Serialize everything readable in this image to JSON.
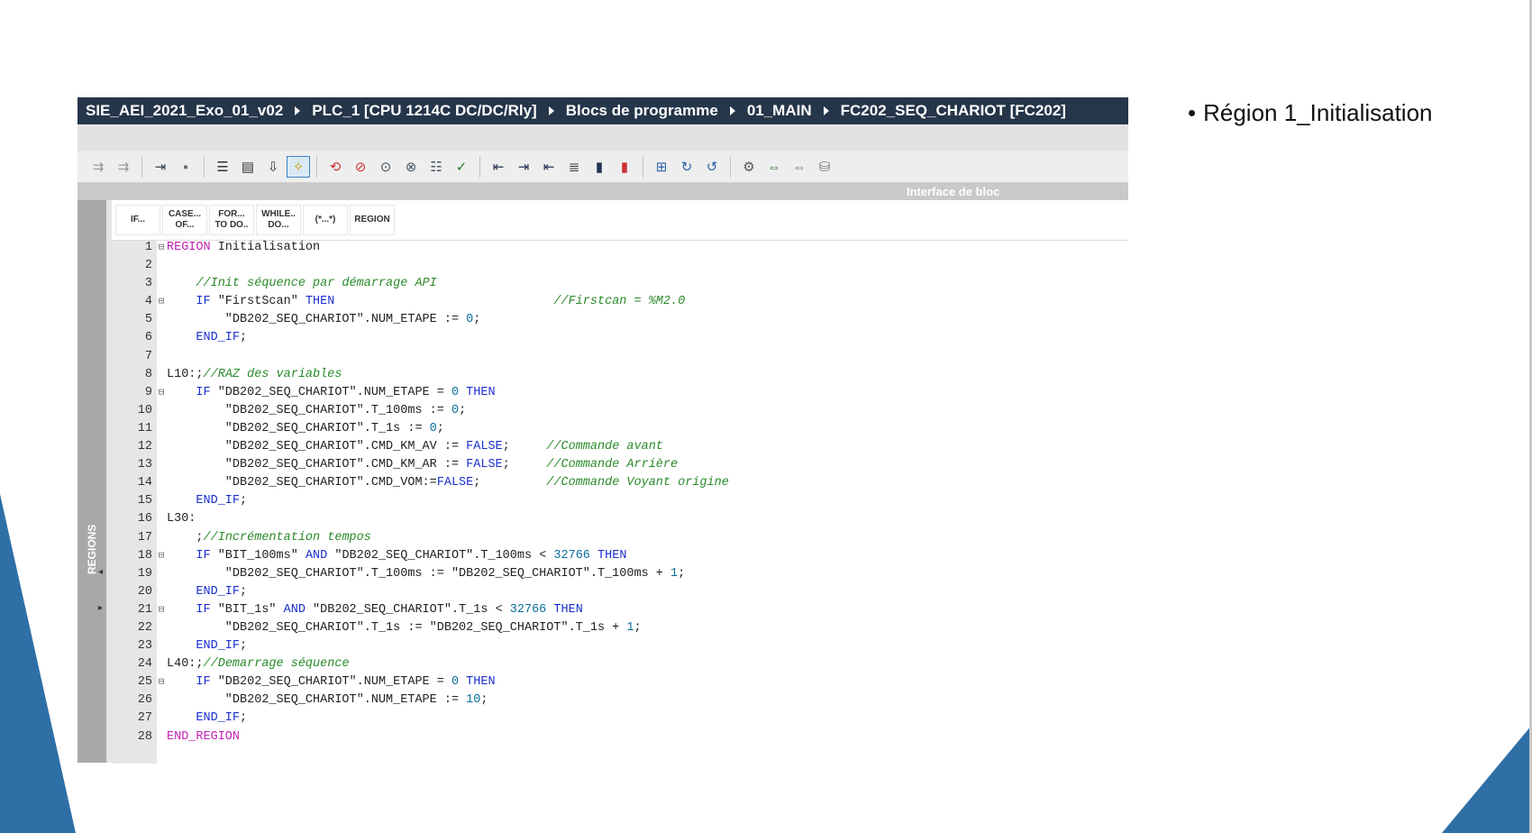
{
  "slide": {
    "bullet": "Région 1_Initialisation"
  },
  "breadcrumb": [
    "SIE_AEI_2021_Exo_01_v02",
    "PLC_1 [CPU 1214C DC/DC/Rly]",
    "Blocs de programme",
    "01_MAIN",
    "FC202_SEQ_CHARIOT [FC202]"
  ],
  "subbar": {
    "label": "Interface de bloc"
  },
  "side_panel": {
    "label": "REGIONS"
  },
  "snippets": [
    "IF...",
    "CASE...\nOF...",
    "FOR...\nTO DO..",
    "WHILE..\nDO...",
    "(*...*)",
    "REGION"
  ],
  "toolbar_icons": [
    "indent-icon",
    "outdent-icon",
    "insert-icon",
    "clear-icon",
    "list-icon",
    "save-icon",
    "download-icon",
    "snippet-icon",
    "goto-icon",
    "delete-breakpoint-icon",
    "monitor-icon",
    "monitor-stop-icon",
    "align-icon",
    "verify-icon",
    "left-arrow-icon",
    "indent-right-icon",
    "indent-left-icon",
    "format-icon",
    "bookmark-icon",
    "bookmark-clear-icon",
    "compile-icon",
    "next-icon",
    "prev-icon",
    "cross-ref-icon",
    "compare-icon",
    "compare-stop-icon",
    "database-icon"
  ],
  "code": [
    {
      "n": "1",
      "fold": "⊟",
      "t": [
        [
          "reg",
          "REGION"
        ],
        [
          "txt",
          " Initialisation"
        ]
      ]
    },
    {
      "n": "2",
      "fold": "",
      "t": []
    },
    {
      "n": "3",
      "fold": "",
      "t": [
        [
          "txt",
          "    "
        ],
        [
          "cm",
          "//Init séquence par démarrage API"
        ]
      ]
    },
    {
      "n": "4",
      "fold": "⊟",
      "t": [
        [
          "txt",
          "    "
        ],
        [
          "kw",
          "IF"
        ],
        [
          "txt",
          " \"FirstScan\" "
        ],
        [
          "kw",
          "THEN"
        ],
        [
          "txt",
          "                              "
        ],
        [
          "cm",
          "//Firstcan = %M2.0"
        ]
      ]
    },
    {
      "n": "5",
      "fold": "",
      "t": [
        [
          "txt",
          "        \"DB202_SEQ_CHARIOT\".NUM_ETAPE := "
        ],
        [
          "num",
          "0"
        ],
        [
          "txt",
          ";"
        ]
      ]
    },
    {
      "n": "6",
      "fold": "",
      "t": [
        [
          "txt",
          "    "
        ],
        [
          "kw",
          "END_IF"
        ],
        [
          "txt",
          ";"
        ]
      ]
    },
    {
      "n": "7",
      "fold": "",
      "t": []
    },
    {
      "n": "8",
      "fold": "",
      "t": [
        [
          "txt",
          "L10:;"
        ],
        [
          "cm",
          "//RAZ des variables"
        ]
      ]
    },
    {
      "n": "9",
      "fold": "⊟",
      "t": [
        [
          "txt",
          "    "
        ],
        [
          "kw",
          "IF"
        ],
        [
          "txt",
          " \"DB202_SEQ_CHARIOT\".NUM_ETAPE = "
        ],
        [
          "num",
          "0"
        ],
        [
          "txt",
          " "
        ],
        [
          "kw",
          "THEN"
        ]
      ]
    },
    {
      "n": "10",
      "fold": "",
      "t": [
        [
          "txt",
          "        \"DB202_SEQ_CHARIOT\".T_100ms := "
        ],
        [
          "num",
          "0"
        ],
        [
          "txt",
          ";"
        ]
      ]
    },
    {
      "n": "11",
      "fold": "",
      "t": [
        [
          "txt",
          "        \"DB202_SEQ_CHARIOT\".T_1s := "
        ],
        [
          "num",
          "0"
        ],
        [
          "txt",
          ";"
        ]
      ]
    },
    {
      "n": "12",
      "fold": "",
      "t": [
        [
          "txt",
          "        \"DB202_SEQ_CHARIOT\".CMD_KM_AV := "
        ],
        [
          "kw",
          "FALSE"
        ],
        [
          "txt",
          ";     "
        ],
        [
          "cm",
          "//Commande avant"
        ]
      ]
    },
    {
      "n": "13",
      "fold": "",
      "t": [
        [
          "txt",
          "        \"DB202_SEQ_CHARIOT\".CMD_KM_AR := "
        ],
        [
          "kw",
          "FALSE"
        ],
        [
          "txt",
          ";     "
        ],
        [
          "cm",
          "//Commande Arrière"
        ]
      ]
    },
    {
      "n": "14",
      "fold": "",
      "t": [
        [
          "txt",
          "        \"DB202_SEQ_CHARIOT\".CMD_VOM:="
        ],
        [
          "kw",
          "FALSE"
        ],
        [
          "txt",
          ";         "
        ],
        [
          "cm",
          "//Commande Voyant origine"
        ]
      ]
    },
    {
      "n": "15",
      "fold": "",
      "t": [
        [
          "txt",
          "    "
        ],
        [
          "kw",
          "END_IF"
        ],
        [
          "txt",
          ";"
        ]
      ]
    },
    {
      "n": "16",
      "fold": "",
      "t": [
        [
          "txt",
          "L30:"
        ]
      ]
    },
    {
      "n": "17",
      "fold": "",
      "t": [
        [
          "txt",
          "    ;"
        ],
        [
          "cm",
          "//Incrémentation tempos"
        ]
      ]
    },
    {
      "n": "18",
      "fold": "⊟",
      "t": [
        [
          "txt",
          "    "
        ],
        [
          "kw",
          "IF"
        ],
        [
          "txt",
          " \"BIT_100ms\" "
        ],
        [
          "kw",
          "AND"
        ],
        [
          "txt",
          " \"DB202_SEQ_CHARIOT\".T_100ms < "
        ],
        [
          "num",
          "32766"
        ],
        [
          "txt",
          " "
        ],
        [
          "kw",
          "THEN"
        ]
      ]
    },
    {
      "n": "19",
      "fold": "",
      "t": [
        [
          "txt",
          "        \"DB202_SEQ_CHARIOT\".T_100ms := \"DB202_SEQ_CHARIOT\".T_100ms + "
        ],
        [
          "num",
          "1"
        ],
        [
          "txt",
          ";"
        ]
      ]
    },
    {
      "n": "20",
      "fold": "",
      "t": [
        [
          "txt",
          "    "
        ],
        [
          "kw",
          "END_IF"
        ],
        [
          "txt",
          ";"
        ]
      ]
    },
    {
      "n": "21",
      "fold": "⊟",
      "t": [
        [
          "txt",
          "    "
        ],
        [
          "kw",
          "IF"
        ],
        [
          "txt",
          " \"BIT_1s\" "
        ],
        [
          "kw",
          "AND"
        ],
        [
          "txt",
          " \"DB202_SEQ_CHARIOT\".T_1s < "
        ],
        [
          "num",
          "32766"
        ],
        [
          "txt",
          " "
        ],
        [
          "kw",
          "THEN"
        ]
      ]
    },
    {
      "n": "22",
      "fold": "",
      "t": [
        [
          "txt",
          "        \"DB202_SEQ_CHARIOT\".T_1s := \"DB202_SEQ_CHARIOT\".T_1s + "
        ],
        [
          "num",
          "1"
        ],
        [
          "txt",
          ";"
        ]
      ]
    },
    {
      "n": "23",
      "fold": "",
      "t": [
        [
          "txt",
          "    "
        ],
        [
          "kw",
          "END_IF"
        ],
        [
          "txt",
          ";"
        ]
      ]
    },
    {
      "n": "24",
      "fold": "",
      "t": [
        [
          "txt",
          "L40:;"
        ],
        [
          "cm",
          "//Demarrage séquence"
        ]
      ]
    },
    {
      "n": "25",
      "fold": "⊟",
      "t": [
        [
          "txt",
          "    "
        ],
        [
          "kw",
          "IF"
        ],
        [
          "txt",
          " \"DB202_SEQ_CHARIOT\".NUM_ETAPE = "
        ],
        [
          "num",
          "0"
        ],
        [
          "txt",
          " "
        ],
        [
          "kw",
          "THEN"
        ]
      ]
    },
    {
      "n": "26",
      "fold": "",
      "t": [
        [
          "txt",
          "        \"DB202_SEQ_CHARIOT\".NUM_ETAPE := "
        ],
        [
          "num",
          "10"
        ],
        [
          "txt",
          ";"
        ]
      ]
    },
    {
      "n": "27",
      "fold": "",
      "t": [
        [
          "txt",
          "    "
        ],
        [
          "kw",
          "END_IF"
        ],
        [
          "txt",
          ";"
        ]
      ]
    },
    {
      "n": "28",
      "fold": "",
      "t": [
        [
          "reg",
          "END_REGION"
        ]
      ]
    }
  ]
}
